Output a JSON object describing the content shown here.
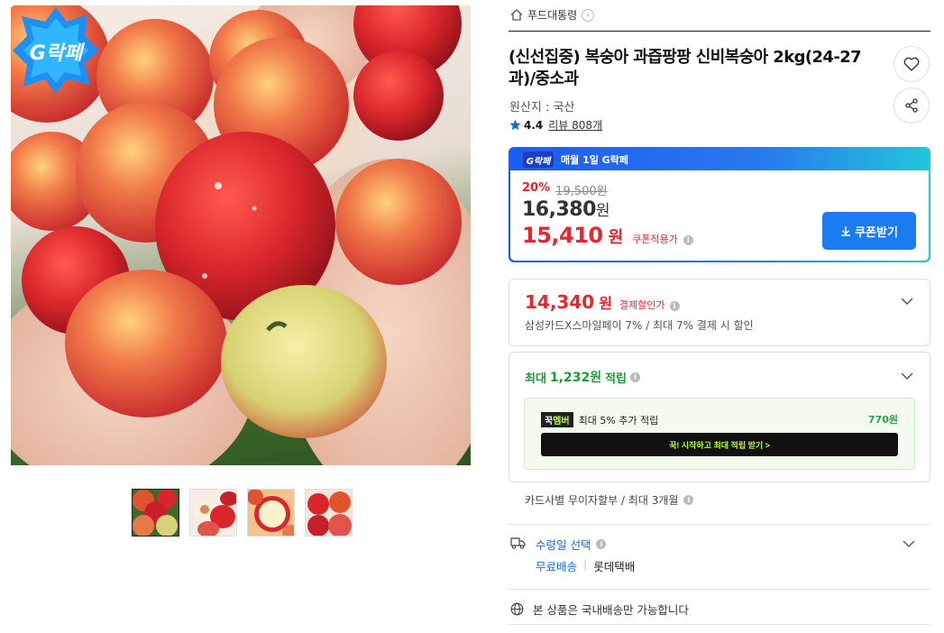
{
  "gallery": {
    "badge_label": "G락페",
    "thumbnails": [
      "thumb-1",
      "thumb-2",
      "thumb-3",
      "thumb-4"
    ],
    "active_index": 0
  },
  "breadcrumb": {
    "icon": "home-icon",
    "seller": "푸드대통령"
  },
  "product": {
    "title": "(신선집중) 복숭아 과즙팡팡 신비복숭아 2kg(24-27과)/중소과",
    "origin": "원산지 : 국산",
    "rating": "4.4",
    "review_label": "리뷰 808개"
  },
  "coupon": {
    "header_badge": "G락페",
    "header_label": "매월 1일 G락페",
    "discount_rate": "20%",
    "original_price": "19,500원",
    "sale_price": "16,380",
    "sale_price_unit": "원",
    "coupon_price": "15,410",
    "coupon_price_unit": "원",
    "coupon_tag": "쿠폰적용가",
    "button_label": "쿠폰받기"
  },
  "payment": {
    "price": "14,340",
    "price_unit": "원",
    "tag": "결제할인가",
    "desc": "삼성카드X스마일페이 7% / 최대 7% 결제 시 할인"
  },
  "reward": {
    "prefix": "최대",
    "amount": "1,232원",
    "suffix": "적립",
    "member_chip_left": "꾹",
    "member_chip_right": "멤버",
    "member_text": "최대 5% 추가 적립",
    "member_amount": "770원",
    "member_button": "꾹! 시작하고 최대 적립 받기  >"
  },
  "installment": "카드사별 무이자할부 / 최대 3개월",
  "shipping": {
    "title": "수령일 선택",
    "free": "무료배송",
    "separator": "|",
    "carrier": "롯데택배"
  },
  "domestic": "본 상품은 국내배송만 가능합니다",
  "colors": {
    "accent_red": "#e8242c",
    "accent_blue": "#1a7cf0",
    "reward_green": "#1c9c35"
  }
}
